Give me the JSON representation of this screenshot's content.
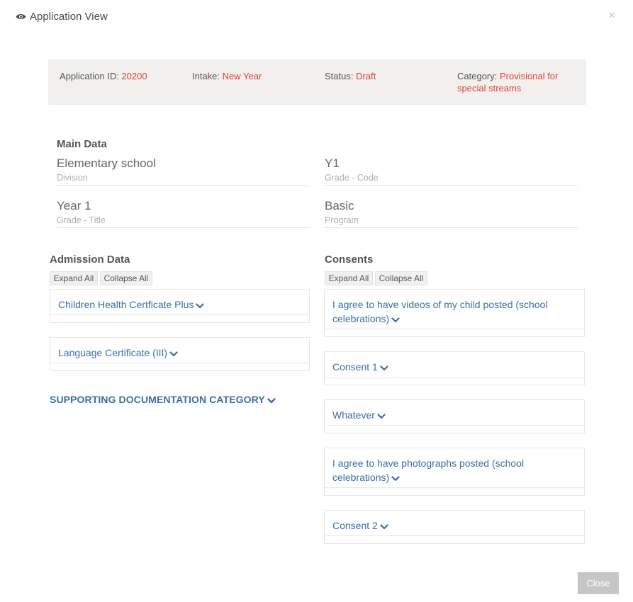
{
  "modal": {
    "title": "Application View",
    "close_symbol": "×",
    "close_button": "Close",
    "title_icon": "eye-icon"
  },
  "summary": {
    "app_id_label": "Application ID:",
    "app_id_value": "20200",
    "intake_label": "Intake:",
    "intake_value": "New Year",
    "status_label": "Status:",
    "status_value": "Draft",
    "category_label": "Category:",
    "category_value_line1": "Provisional for",
    "category_value_line2": "special streams"
  },
  "main_data": {
    "title": "Main Data",
    "fields": [
      {
        "value": "Elementary school",
        "label": "Division"
      },
      {
        "value": "Y1",
        "label": "Grade - Code"
      },
      {
        "value": "Year 1",
        "label": "Grade - Title"
      },
      {
        "value": "Basic",
        "label": "Program"
      }
    ]
  },
  "admission": {
    "title": "Admission Data",
    "expand_all": "Expand All",
    "collapse_all": "Collapse All",
    "items": [
      {
        "title": "Children Health Certficate Plus"
      },
      {
        "title": "Language Certificate (III)"
      }
    ],
    "supporting_docs": "SUPPORTING DOCUMENTATION CATEGORY"
  },
  "consents": {
    "title": "Consents",
    "expand_all": "Expand All",
    "collapse_all": "Collapse All",
    "items": [
      {
        "title": "I agree to have videos of my child posted (school celebrations)"
      },
      {
        "title": "Consent 1"
      },
      {
        "title": "Whatever"
      },
      {
        "title": "I agree to have photographs posted (school celebrations)"
      },
      {
        "title": "Consent 2"
      }
    ]
  },
  "colors": {
    "link": "#3a6ea8",
    "accent_red": "#e0403a",
    "summary_bg": "#f1f0ef",
    "close_button_bg": "#c6c6c6"
  }
}
